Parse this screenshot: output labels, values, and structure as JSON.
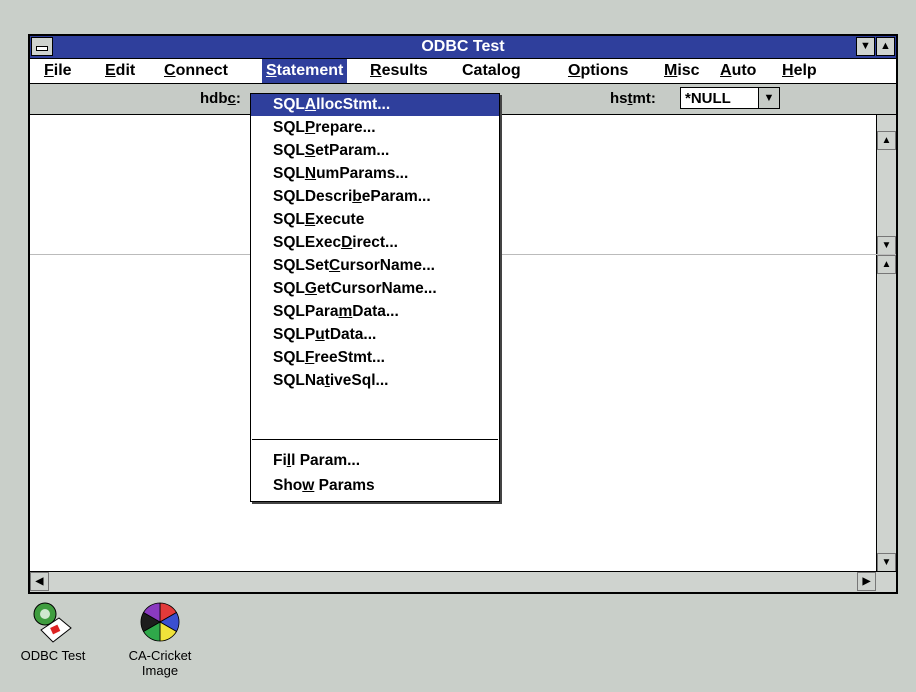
{
  "window": {
    "title": "ODBC Test"
  },
  "menubar": {
    "items": [
      {
        "pre": "",
        "key": "F",
        "post": "ile"
      },
      {
        "pre": "",
        "key": "E",
        "post": "dit"
      },
      {
        "pre": "",
        "key": "C",
        "post": "onnect"
      },
      {
        "pre": "",
        "key": "S",
        "post": "tatement"
      },
      {
        "pre": "",
        "key": "R",
        "post": "esults"
      },
      {
        "pre": "Catalo",
        "key": "g",
        "post": ""
      },
      {
        "pre": "",
        "key": "O",
        "post": "ptions"
      },
      {
        "pre": "",
        "key": "M",
        "post": "isc"
      },
      {
        "pre": "",
        "key": "A",
        "post": "uto"
      },
      {
        "pre": "",
        "key": "H",
        "post": "elp"
      }
    ]
  },
  "toolbar": {
    "hdbc_pre": "hdb",
    "hdbc_key": "c",
    "hdbc_post": ":",
    "hstmt_pre": "hs",
    "hstmt_key": "t",
    "hstmt_post": "mt:",
    "hstmt_value": "*NULL"
  },
  "dropdown": {
    "items": [
      {
        "pre": "SQL",
        "key": "A",
        "post": "llocStmt..."
      },
      {
        "pre": "SQL",
        "key": "P",
        "post": "repare..."
      },
      {
        "pre": "SQL",
        "key": "S",
        "post": "etParam..."
      },
      {
        "pre": "SQL",
        "key": "N",
        "post": "umParams..."
      },
      {
        "pre": "SQLDescri",
        "key": "b",
        "post": "eParam..."
      },
      {
        "pre": "SQL",
        "key": "E",
        "post": "xecute"
      },
      {
        "pre": "SQLExec",
        "key": "D",
        "post": "irect..."
      },
      {
        "pre": "SQLSet",
        "key": "C",
        "post": "ursorName..."
      },
      {
        "pre": "SQL",
        "key": "G",
        "post": "etCursorName..."
      },
      {
        "pre": "SQLPara",
        "key": "m",
        "post": "Data..."
      },
      {
        "pre": "SQLP",
        "key": "u",
        "post": "tData..."
      },
      {
        "pre": "SQL",
        "key": "F",
        "post": "reeStmt..."
      },
      {
        "pre": "SQLNa",
        "key": "t",
        "post": "iveSql..."
      },
      {
        "pre": "Fi",
        "key": "l",
        "post": "l Param..."
      },
      {
        "pre": "Sho",
        "key": "w",
        "post": " Params"
      }
    ]
  },
  "desktop": {
    "icons": [
      {
        "label": "ODBC Test",
        "label2": ""
      },
      {
        "label": "CA-Cricket",
        "label2": "Image"
      }
    ]
  },
  "colors": {
    "titlebar": "#2f3f9c",
    "highlight": "#2f3f9c",
    "desktop": "#c9cfc9",
    "toolbar": "#c6cbc6"
  }
}
